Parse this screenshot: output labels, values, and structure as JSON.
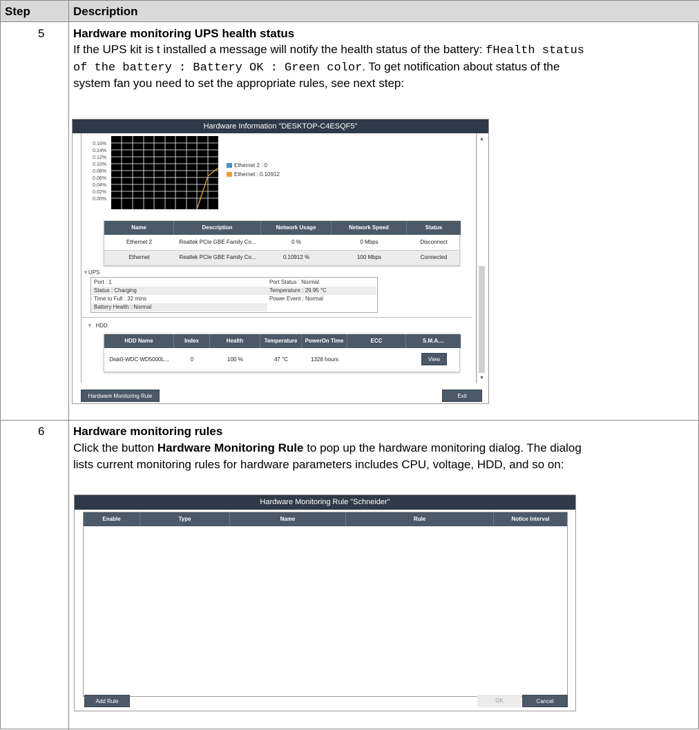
{
  "table": {
    "header": {
      "step": "Step",
      "description": "Description"
    },
    "rows": [
      {
        "step": "5",
        "title": "Hardware monitoring UPS health status",
        "line1_a": "If the UPS kit is t installed a message will notify the health status of the battery: ",
        "line1_code": "fHealth status",
        "line2_code": "of the battery : Battery OK : Green color",
        "line2_b": ". To get notification about status of the",
        "line3": "system fan you need to set the appropriate rules, see next step:"
      },
      {
        "step": "6",
        "title": "Hardware monitoring rules",
        "line1_a": "Click the button ",
        "line1_bold": "Hardware Monitoring Rule",
        "line1_b": " to pop up the hardware monitoring dialog. The dialog",
        "line2": "lists current monitoring rules for hardware parameters includes CPU, voltage, HDD, and so on:"
      }
    ]
  },
  "hw_info_dialog": {
    "title": "Hardware Information \"DESKTOP-C4ESQF5\"",
    "chart": {
      "y_ticks": [
        "0.16%",
        "0.14%",
        "0.12%",
        "0.10%",
        "0.08%",
        "0.06%",
        "0.04%",
        "0.02%",
        "0.00%"
      ],
      "legend": [
        {
          "label": "Ethernet 2 : 0",
          "color": "#4a90c8"
        },
        {
          "label": "Ethernet : 0.10912",
          "color": "#f0a030"
        }
      ]
    },
    "network_table": {
      "headers": [
        "Name",
        "Description",
        "Network Usage",
        "Network Speed",
        "Status"
      ],
      "rows": [
        [
          "Ethernet 2",
          "Realtek PCIe GBE Family Co...",
          "0 %",
          "0 Mbps",
          "Disconnect"
        ],
        [
          "Ethernet",
          "Realtek PCIe GBE Family Co...",
          "0.10912 %",
          "100 Mbps",
          "Connected"
        ]
      ]
    },
    "ups": {
      "label": "UPS",
      "left": [
        "Port : 1",
        "Status : Charging",
        "Time to Full : 32 mins",
        "Battery Health : Normal"
      ],
      "right": [
        "Port Status : Normal",
        "Temperature : 29.95 °C",
        "Power Event : Normal"
      ]
    },
    "hdd": {
      "label": "HDD",
      "headers": [
        "HDD Name",
        "Index",
        "Health",
        "Temperature",
        "PowerOn Time",
        "ECC",
        "S.M.A...."
      ],
      "row": [
        "Disk0-WDC WD5000L...",
        "0",
        "100 %",
        "47 °C",
        "1328 hours",
        ""
      ],
      "view_button": "View"
    },
    "buttons": {
      "rule": "Hardware Monitoring Rule",
      "exit": "Exit"
    }
  },
  "hw_rule_dialog": {
    "title": "Hardware Monitoring Rule \"Schneider\"",
    "headers": [
      "Enable",
      "Type",
      "Name",
      "Rule",
      "Notice Interval"
    ],
    "buttons": {
      "add_rule": "Add Rule",
      "ok": "OK",
      "cancel": "Cancel"
    }
  }
}
